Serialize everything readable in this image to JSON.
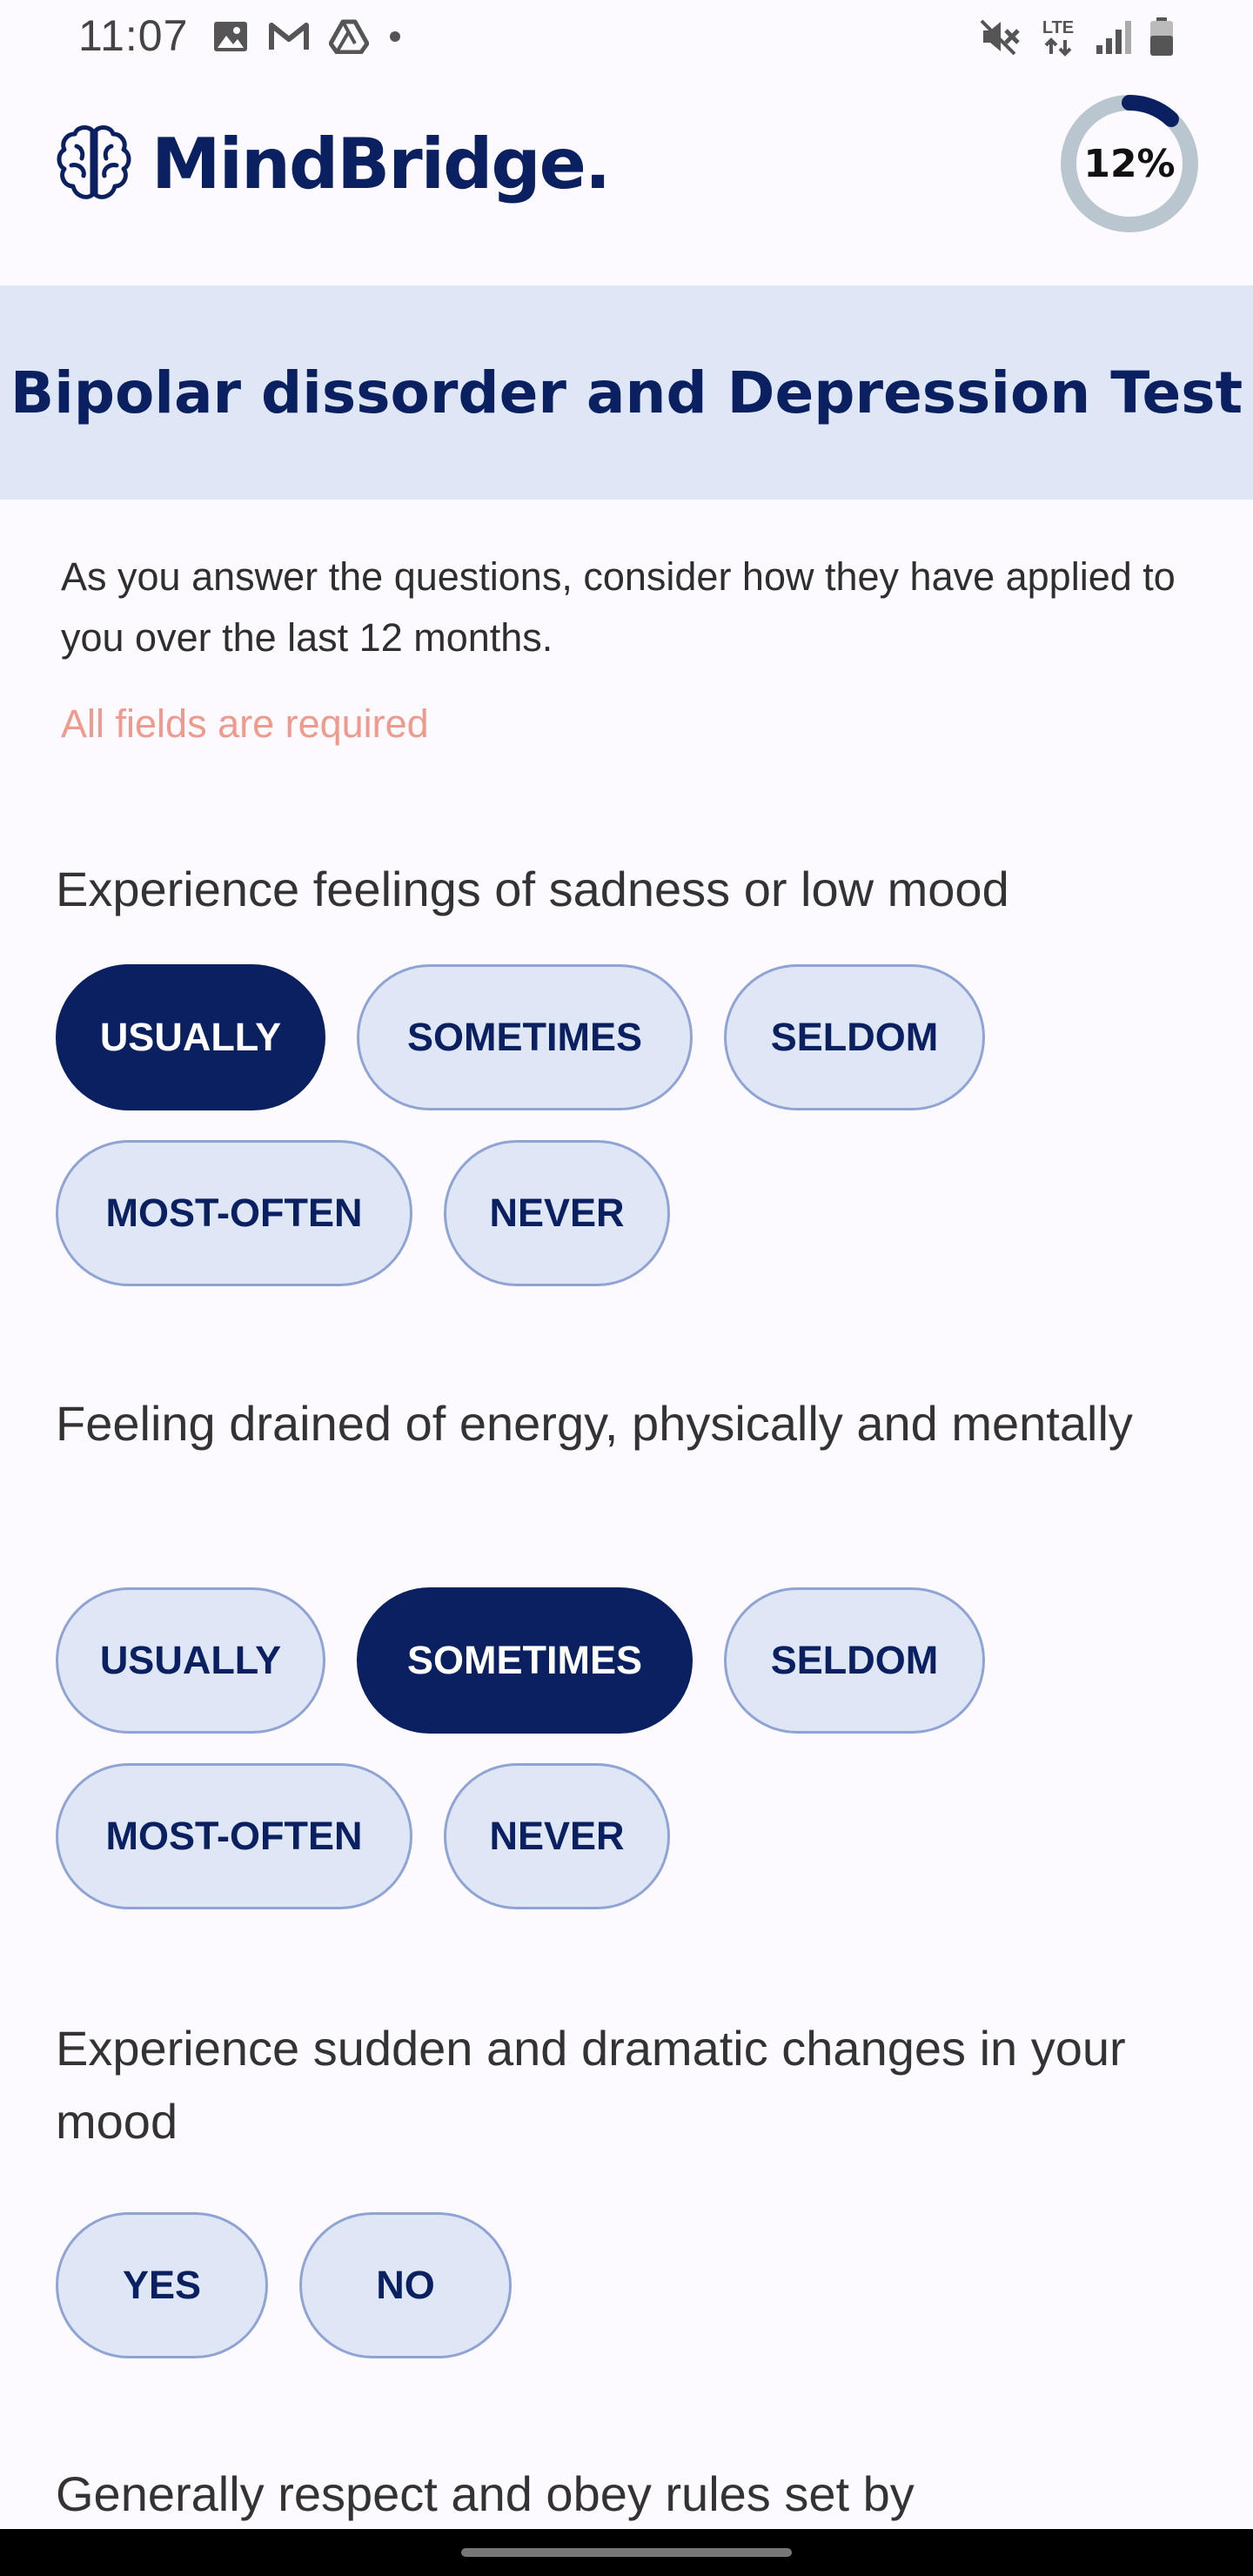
{
  "status_bar": {
    "time": "11:07",
    "left_icons": [
      "image-icon",
      "gmail-icon",
      "drive-icon",
      "dot-icon"
    ],
    "right_icons": [
      "mute-icon",
      "lte-icon",
      "signal-icon",
      "battery-icon"
    ],
    "lte_label": "LTE"
  },
  "header": {
    "brand": "MindBridge.",
    "progress_label": "12%",
    "progress_value": 0.12,
    "accent_color": "#0b2060"
  },
  "title": "Bipolar dissorder and Depression Test",
  "intro": "As you answer the questions, consider how they have applied to you over the last 12 months.",
  "required_note": "All fields are required",
  "questions": [
    {
      "text": "Experience feelings of sadness or low mood",
      "options": [
        "USUALLY",
        "SOMETIMES",
        "SELDOM",
        "MOST-OFTEN",
        "NEVER"
      ],
      "selected": "USUALLY"
    },
    {
      "text": "Feeling drained of energy, physically and mentally",
      "options": [
        "USUALLY",
        "SOMETIMES",
        "SELDOM",
        "MOST-OFTEN",
        "NEVER"
      ],
      "selected": "SOMETIMES"
    },
    {
      "text": "Experience sudden and dramatic changes in your mood",
      "options": [
        "YES",
        "NO"
      ],
      "selected": ""
    },
    {
      "text": "Generally respect and obey rules set by"
    }
  ]
}
